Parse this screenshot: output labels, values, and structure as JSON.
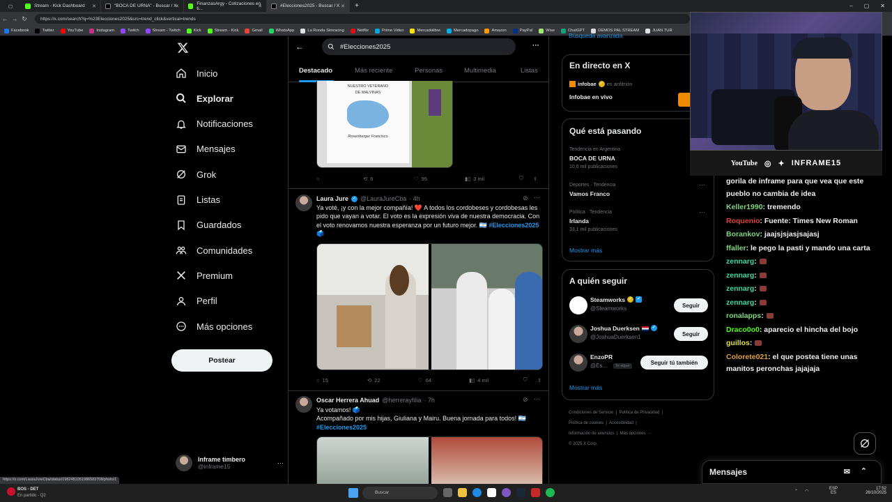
{
  "browser": {
    "tabs": [
      {
        "title": "Stream - Kick Dashboard",
        "color": "#53fc18"
      },
      {
        "title": "\"BOCA DE URNA\" - Buscar / X",
        "color": "#ffffff"
      },
      {
        "title": "FinanzasArgy - Cotizaciones en ti...",
        "color": "#53fc18"
      },
      {
        "title": "#Elecciones2025 - Buscar / X",
        "color": "#ffffff"
      }
    ],
    "url": "https://x.com/search?q=%23Elecciones2025&src=trend_click&vertical=trends",
    "bookmarks": [
      "Facebook",
      "Twitter",
      "YouTube",
      "Instagram",
      "Twitch",
      "Stream - Twitch",
      "Kick",
      "Stream - Kick",
      "Gmail",
      "WhatsApp",
      "La Ronda Simracing",
      "Netflix",
      "Prime Video",
      "Mercadolibre",
      "Mercadopago",
      "Amazon",
      "PayPal",
      "Wise",
      "ChatGPT",
      "DEMOS PAL STREAM",
      "JUAN TUR"
    ],
    "bookmark_colors": [
      "#1877f2",
      "#000000",
      "#ff0000",
      "#c13584",
      "#9146ff",
      "#9146ff",
      "#53fc18",
      "#53fc18",
      "#ea4335",
      "#25d366",
      "#e0e0e0",
      "#e50914",
      "#00a8e1",
      "#ffe600",
      "#00b1ea",
      "#ff9900",
      "#003087",
      "#9fe870",
      "#10a37f",
      "#e0e0e0",
      "#e0e0e0"
    ],
    "status_url": "https://x.com/LauraJureCba/status/1982481051986583708/photo/1"
  },
  "nav": {
    "items": [
      {
        "label": "Inicio",
        "icon": "home-icon"
      },
      {
        "label": "Explorar",
        "icon": "search-icon"
      },
      {
        "label": "Notificaciones",
        "icon": "bell-icon"
      },
      {
        "label": "Mensajes",
        "icon": "mail-icon"
      },
      {
        "label": "Grok",
        "icon": "grok-icon"
      },
      {
        "label": "Listas",
        "icon": "list-icon"
      },
      {
        "label": "Guardados",
        "icon": "bookmark-icon"
      },
      {
        "label": "Comunidades",
        "icon": "people-icon"
      },
      {
        "label": "Premium",
        "icon": "x-icon"
      },
      {
        "label": "Perfil",
        "icon": "person-icon"
      },
      {
        "label": "Más opciones",
        "icon": "more-icon"
      }
    ],
    "post_label": "Postear",
    "account_name": "Inframe timbero",
    "account_handle": "@inframe15"
  },
  "search": {
    "query": "#Elecciones2025",
    "tabs": [
      "Destacado",
      "Más reciente",
      "Personas",
      "Multimedia",
      "Listas"
    ]
  },
  "tweets": {
    "t0": {
      "image_caption_line1": "NUESTRO VETERANO",
      "image_caption_line2": "DE MALVINAS",
      "image_name": "Rosenberger Francisco",
      "replies": "",
      "retweets": "6",
      "likes": "95",
      "views": "3 mil"
    },
    "t1": {
      "name": "Laura Jure",
      "handle": "@LauraJureCba",
      "time": "· 4h",
      "text": "Ya voté, ¡y con la mejor compañía! ❤️ A todos los cordobeses y cordobesas les pido que vayan a votar. El voto es la expresión viva de nuestra democracia. Con el voto renovamos nuestra esperanza por un futuro mejor. 🇦🇷",
      "hashtag": "#Elecciones2025",
      "replies": "15",
      "retweets": "22",
      "likes": "64",
      "views": "4 mil"
    },
    "t2": {
      "name": "Oscar Herrera Ahuad",
      "handle": "@herrerayfilia",
      "time": "· 7h",
      "line1": "Ya votamos! 🗳️",
      "line2": "Acompañado por mis hijas, Giuliana y Mairu. Buena jornada para todos! 🇦🇷",
      "hashtag": "#Elecciones2025"
    }
  },
  "right": {
    "top_link": "Búsqueda avanzada",
    "live_title": "En directo en X",
    "live_host": "infobae",
    "live_host_role": "es anfitrión",
    "live_stream": "Infobae en vivo",
    "trends_title": "Qué está pasando",
    "trends": [
      {
        "cat": "Tendencia en Argentina",
        "name": "BOCA DE URNA",
        "count": "10,6 mil publicaciones"
      },
      {
        "cat": "Deportes · Tendencia",
        "name": "Vamos Franco",
        "count": ""
      },
      {
        "cat": "Política · Tendencia",
        "name": "Irlanda",
        "count": "33,1 mil publicaciones"
      }
    ],
    "show_more": "Mostrar más",
    "follow_title": "A quién seguir",
    "follow": [
      {
        "name": "Steamworks",
        "handle": "@Steamworks",
        "btn": "Seguir"
      },
      {
        "name": "Joshua Duerksen",
        "handle": "@JoshuaDuerksen1",
        "btn": "Seguir"
      },
      {
        "name": "EnzoPR",
        "handle": "@Es...",
        "tag": "Te sigue",
        "btn": "Seguir tú también"
      }
    ],
    "follow_more": "Mostrar más",
    "footer": [
      "Condiciones de Servicio",
      "Política de Privacidad",
      "Política de cookies",
      "Accesibilidad",
      "Información de anuncios",
      "Más opciones ···",
      "© 2025 X Corp."
    ]
  },
  "stream": {
    "social": [
      "YouTube",
      "INFRAME15"
    ],
    "chat": [
      {
        "user": "",
        "color": "#ffffff",
        "text": "gorila de inframe para que vea que este pueblo no cambia de idea"
      },
      {
        "user": "Keller1990",
        "color": "#7fd67f",
        "text": ": tremendo"
      },
      {
        "user": "Roquenio",
        "color": "#e04040",
        "text": ": Fuente: Times New Roman"
      },
      {
        "user": "Borankov",
        "color": "#7fd67f",
        "text": ": jaajsjsjasjsajasj"
      },
      {
        "user": "ffaller",
        "color": "#7fd67f",
        "text": ": le pego la pasti y mando una carta"
      },
      {
        "user": "zennarg",
        "color": "#3fd9a0",
        "text": ":"
      },
      {
        "user": "zennarg",
        "color": "#3fd9a0",
        "text": ":"
      },
      {
        "user": "zennarg",
        "color": "#3fd9a0",
        "text": ":"
      },
      {
        "user": "zennarg",
        "color": "#3fd9a0",
        "text": ":"
      },
      {
        "user": "ronalapps",
        "color": "#7fd67f",
        "text": ":"
      },
      {
        "user": "Draco0o0",
        "color": "#53fc18",
        "text": ": aparecio el hincha del bojo"
      },
      {
        "user": "guillos",
        "color": "#e0e040",
        "text": ":"
      },
      {
        "user": "Colorete021",
        "color": "#e0a040",
        "text": ": el que postea tiene unas manitos peronchas jajajaja"
      }
    ],
    "messages_label": "Mensajes"
  },
  "taskbar": {
    "left_title": "BOS - DET",
    "left_sub": "En partido - Q2",
    "search": "Buscar",
    "lang": "ESP",
    "lang_sub": "ES",
    "time": "17:52",
    "date": "26/10/2025"
  }
}
